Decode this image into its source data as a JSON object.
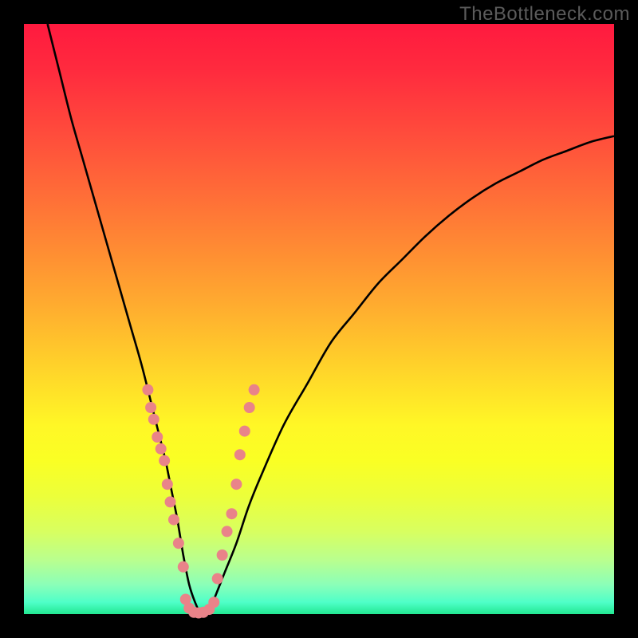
{
  "watermark": "TheBottleneck.com",
  "chart_data": {
    "type": "line",
    "title": "",
    "xlabel": "",
    "ylabel": "",
    "xlim": [
      0,
      100
    ],
    "ylim": [
      0,
      100
    ],
    "grid": false,
    "legend": false,
    "series": [
      {
        "name": "bottleneck-curve",
        "color": "#000000",
        "x": [
          4,
          6,
          8,
          10,
          12,
          14,
          16,
          18,
          20,
          22,
          23,
          24,
          25,
          26,
          27,
          28,
          29,
          30,
          31,
          32,
          34,
          36,
          38,
          40,
          44,
          48,
          52,
          56,
          60,
          64,
          68,
          72,
          76,
          80,
          84,
          88,
          92,
          96,
          100
        ],
        "y": [
          100,
          92,
          84,
          77,
          70,
          63,
          56,
          49,
          42,
          34,
          30,
          26,
          21,
          16,
          10,
          5,
          2,
          0,
          0,
          2,
          7,
          12,
          18,
          23,
          32,
          39,
          46,
          51,
          56,
          60,
          64,
          67.5,
          70.5,
          73,
          75,
          77,
          78.5,
          80,
          81
        ]
      }
    ],
    "markers": {
      "name": "data-points",
      "color": "#e98389",
      "radius_px": 7,
      "points": [
        {
          "x": 21.0,
          "y": 38
        },
        {
          "x": 21.5,
          "y": 35
        },
        {
          "x": 22.0,
          "y": 33
        },
        {
          "x": 22.6,
          "y": 30
        },
        {
          "x": 23.2,
          "y": 28
        },
        {
          "x": 23.8,
          "y": 26
        },
        {
          "x": 24.3,
          "y": 22
        },
        {
          "x": 24.8,
          "y": 19
        },
        {
          "x": 25.4,
          "y": 16
        },
        {
          "x": 26.2,
          "y": 12
        },
        {
          "x": 27.0,
          "y": 8
        },
        {
          "x": 27.4,
          "y": 2.5
        },
        {
          "x": 28.0,
          "y": 1.0
        },
        {
          "x": 28.8,
          "y": 0.3
        },
        {
          "x": 29.6,
          "y": 0.2
        },
        {
          "x": 30.4,
          "y": 0.3
        },
        {
          "x": 31.4,
          "y": 0.8
        },
        {
          "x": 32.2,
          "y": 2.0
        },
        {
          "x": 32.8,
          "y": 6
        },
        {
          "x": 33.6,
          "y": 10
        },
        {
          "x": 34.4,
          "y": 14
        },
        {
          "x": 35.2,
          "y": 17
        },
        {
          "x": 36.0,
          "y": 22
        },
        {
          "x": 36.6,
          "y": 27
        },
        {
          "x": 37.4,
          "y": 31
        },
        {
          "x": 38.2,
          "y": 35
        },
        {
          "x": 39.0,
          "y": 38
        }
      ]
    }
  }
}
